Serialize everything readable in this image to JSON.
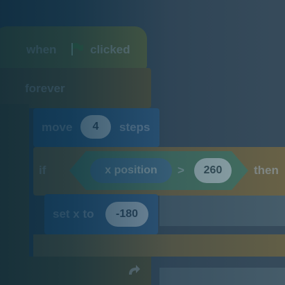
{
  "script": {
    "hat": {
      "prefix": "when",
      "flag_icon": "green-flag-icon",
      "suffix": "clicked",
      "color": "#ffbf00"
    },
    "forever": {
      "label": "forever",
      "color": "#ffab19"
    },
    "move": {
      "prefix": "move",
      "value": "4",
      "suffix": "steps",
      "color": "#4c97ff"
    },
    "if_block": {
      "keyword": "if",
      "then": "then",
      "color": "#ffab19",
      "condition": {
        "reporter": "x position",
        "operator": ">",
        "value": "260",
        "color": "#59c059",
        "reporter_color": "#4c97ff"
      }
    },
    "set_x": {
      "label": "set x to",
      "value": "-180",
      "color": "#4c97ff"
    },
    "loop_arrow_icon": "loop-arrow-icon"
  }
}
